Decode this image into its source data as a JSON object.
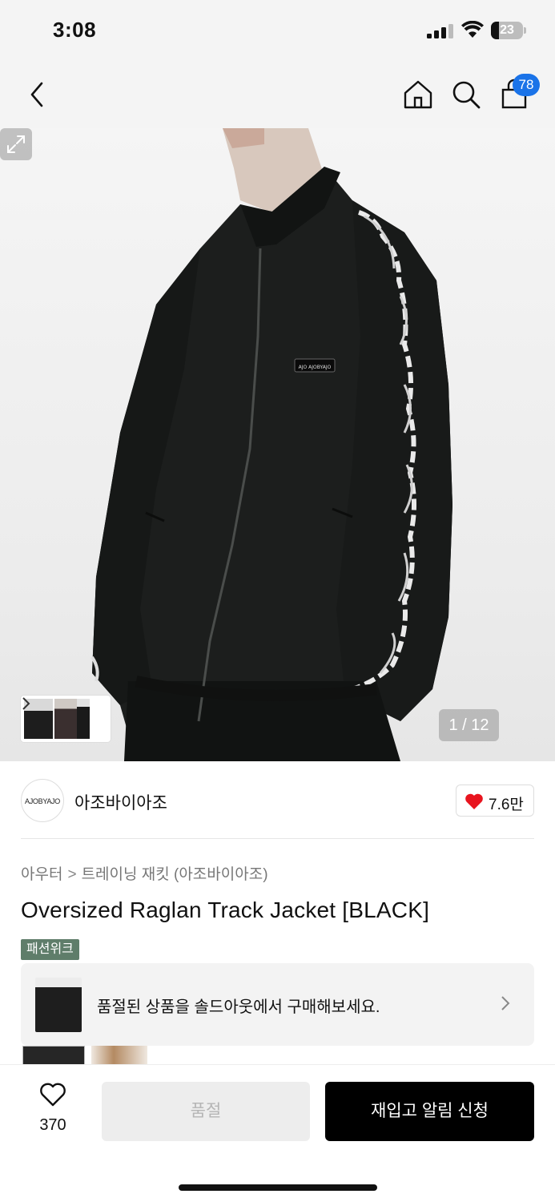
{
  "status_bar": {
    "time": "3:08",
    "battery": "23"
  },
  "header": {
    "cart_count": "78"
  },
  "hero": {
    "counter": "1 / 12"
  },
  "brand": {
    "logo_text": "AJOBYAJO",
    "name": "아조바이아조",
    "likes": "7.6만"
  },
  "breadcrumb": {
    "category": "아우터",
    "separator": ">",
    "subcategory": "트레이닝 재킷 (아조바이아조)"
  },
  "product": {
    "title": "Oversized Raglan Track Jacket [BLACK]",
    "tag": "패션위크"
  },
  "soldout_banner": {
    "text": "품절된 상품을 솔드아웃에서 구매해보세요."
  },
  "bottom_bar": {
    "wish_count": "370",
    "soldout_label": "품절",
    "restock_label": "재입고 알림 신청"
  },
  "colors": {
    "accent_blue": "#1a73e8",
    "tag_green": "#5f7d6a",
    "heart_red": "#e8141e",
    "primary_button": "#000000"
  },
  "icons": [
    "back-icon",
    "home-icon",
    "search-icon",
    "shopping-bag-icon",
    "expand-icon",
    "heart-icon",
    "chevron-right-icon"
  ]
}
